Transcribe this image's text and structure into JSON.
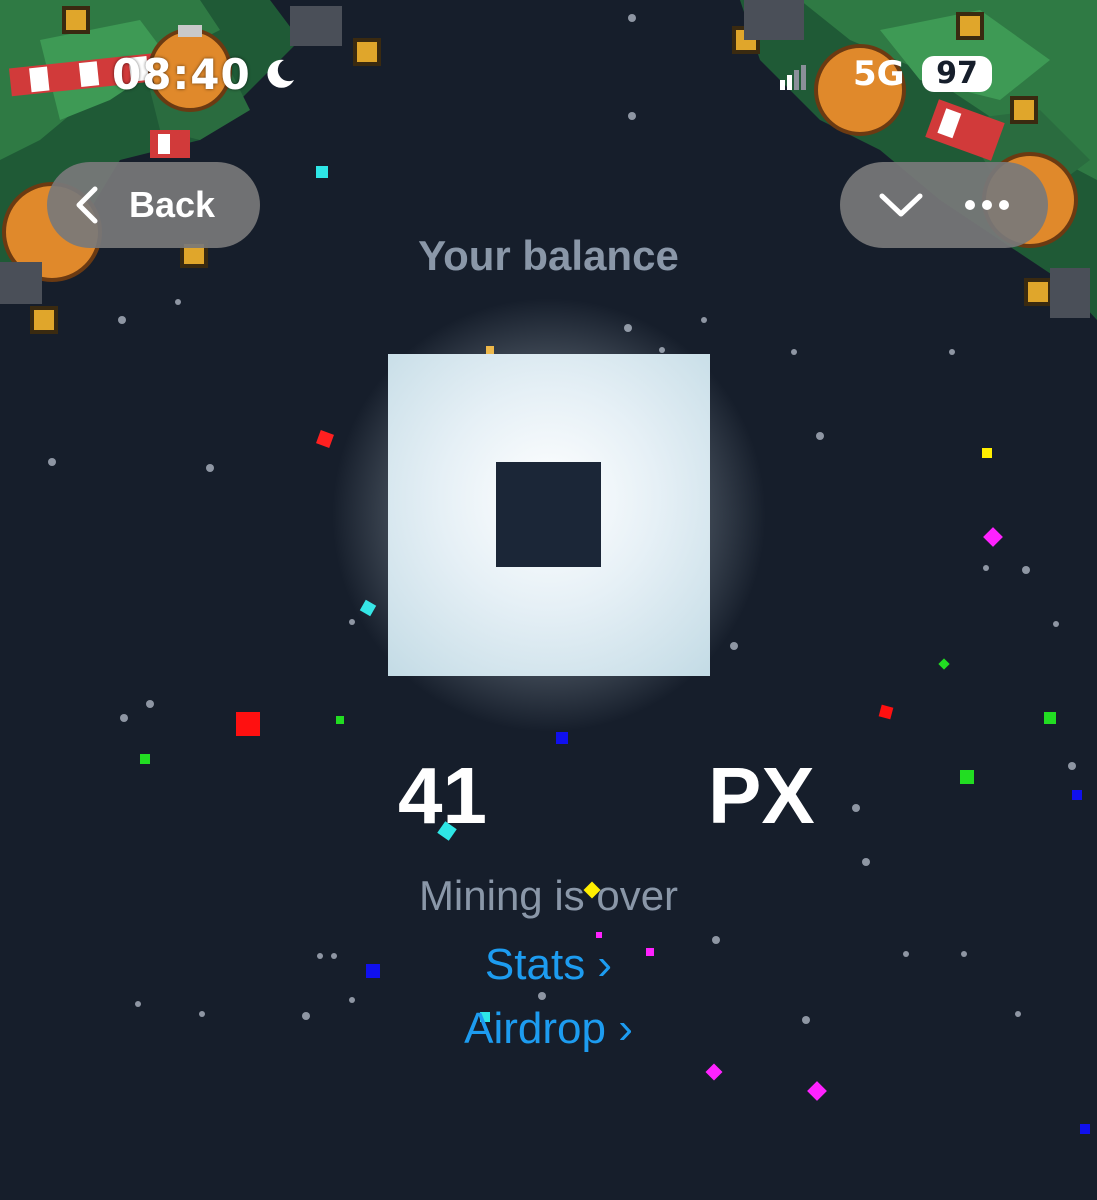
{
  "status_bar": {
    "time": "08:40",
    "moon_icon": "moon-icon",
    "signal_icon": "signal-icon",
    "network": "5G",
    "battery": "97"
  },
  "nav": {
    "back_label": "Back",
    "back_icon": "chevron-left-icon",
    "collapse_icon": "chevron-down-icon",
    "more_icon": "more-dots-icon"
  },
  "balance": {
    "title": "Your balance",
    "amount": "41",
    "unit": "PX"
  },
  "mining": {
    "status": "Mining is over"
  },
  "links": {
    "stats": "Stats ›",
    "airdrop": "Airdrop ›"
  },
  "colors": {
    "background": "#161e2b",
    "muted_text": "#8a97a8",
    "link": "#1d9cf0",
    "pill": "#78787a"
  }
}
